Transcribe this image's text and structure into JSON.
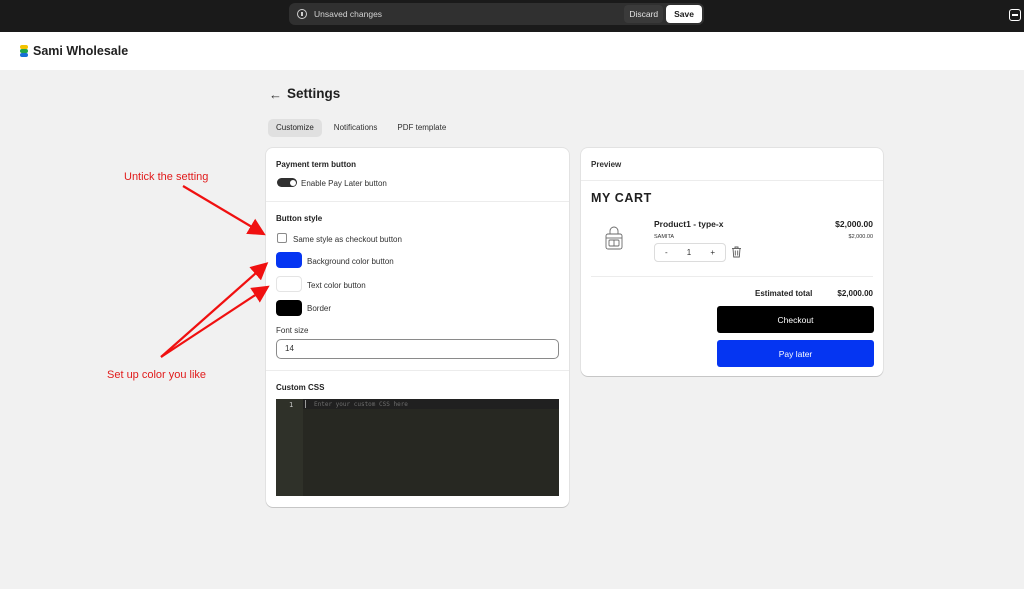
{
  "topbar": {
    "unsaved_text": "Unsaved changes",
    "discard_label": "Discard",
    "save_label": "Save"
  },
  "header": {
    "brand": "Sami Wholesale"
  },
  "page": {
    "title": "Settings",
    "tabs": [
      {
        "label": "Customize",
        "active": true
      },
      {
        "label": "Notifications",
        "active": false
      },
      {
        "label": "PDF template",
        "active": false
      }
    ]
  },
  "settings": {
    "payment_term": {
      "title": "Payment term button",
      "toggle_label": "Enable Pay Later button",
      "enabled": true
    },
    "button_style": {
      "title": "Button style",
      "same_style_label": "Same style as checkout button",
      "same_style_checked": false,
      "background_label": "Background color button",
      "background_color": "#0535f2",
      "text_label": "Text color button",
      "text_color": "#ffffff",
      "border_label": "Border",
      "border_color": "#000000",
      "font_size_label": "Font size",
      "font_size_value": "14"
    },
    "custom_css": {
      "title": "Custom CSS",
      "line_number": "1",
      "placeholder": "Enter your custom CSS here"
    }
  },
  "preview": {
    "title": "Preview",
    "cart_title": "MY CART",
    "product": {
      "name": "Product1 - type-x",
      "vendor": "SAMITA",
      "price": "$2,000.00",
      "subtotal": "$2,000.00",
      "quantity": "1",
      "minus": "-",
      "plus": "+"
    },
    "estimated_label": "Estimated total",
    "estimated_value": "$2,000.00",
    "checkout_label": "Checkout",
    "paylater_label": "Pay later"
  },
  "annotations": {
    "untick": "Untick the setting",
    "setup_color": "Set up color you like"
  },
  "colors": {
    "accent_blue": "#0535f2",
    "annotation_red": "#e11b1b",
    "topbar": "#1a1a1a"
  }
}
